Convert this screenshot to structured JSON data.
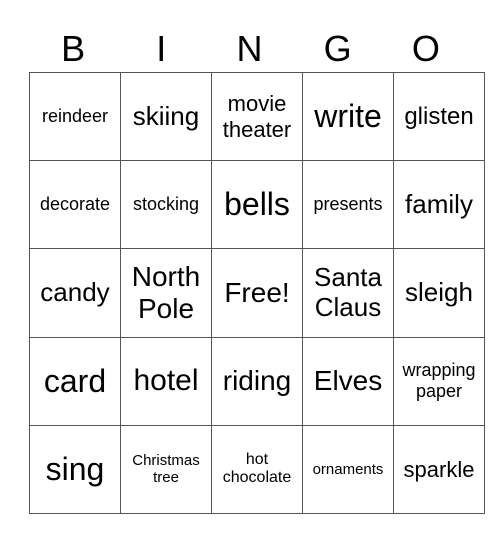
{
  "header": {
    "letters": [
      "B",
      "I",
      "N",
      "G",
      "O"
    ]
  },
  "grid": {
    "rows": [
      [
        "reindeer",
        "skiing",
        "movie theater",
        "write",
        "glisten"
      ],
      [
        "decorate",
        "stocking",
        "bells",
        "presents",
        "family"
      ],
      [
        "candy",
        "North Pole",
        "Free!",
        "Santa Claus",
        "sleigh"
      ],
      [
        "card",
        "hotel",
        "riding",
        "Elves",
        "wrapping paper"
      ],
      [
        "sing",
        "Christmas tree",
        "hot chocolate",
        "ornaments",
        "sparkle"
      ]
    ]
  }
}
